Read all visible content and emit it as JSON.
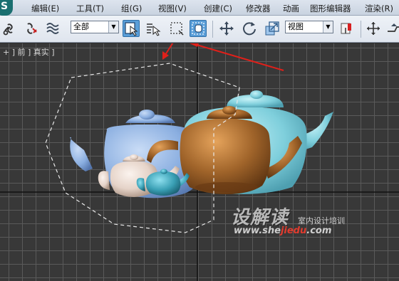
{
  "app": {
    "logo_glyph": "S"
  },
  "menu": [
    {
      "label": "编辑(E)"
    },
    {
      "label": "工具(T)"
    },
    {
      "label": "组(G)"
    },
    {
      "label": "视图(V)"
    },
    {
      "label": "创建(C)"
    },
    {
      "label": "修改器"
    },
    {
      "label": "动画"
    },
    {
      "label": "图形编辑器"
    },
    {
      "label": "渲染(R)"
    }
  ],
  "toolbar": {
    "selection_filter": "全部",
    "coordinate_system": "视图",
    "icons": [
      "link-icon",
      "unlink-icon",
      "bind-space-warp-icon",
      "select-object-icon",
      "select-by-name-icon",
      "selection-region-icon",
      "window-crossing-icon",
      "move-icon",
      "rotate-icon",
      "scale-icon",
      "pivot-icon",
      "manipulate-icon"
    ]
  },
  "viewport": {
    "label": "+ ] 前 ] 真实 ]",
    "view_name": "前",
    "shading": "真实",
    "grid_color": "#5a5a5a",
    "background_color": "#383838"
  },
  "scene_objects": [
    {
      "name": "teapot-cyan",
      "color": "#8fd3e0"
    },
    {
      "name": "teapot-blue",
      "color": "#8aaee0"
    },
    {
      "name": "teapot-orange",
      "color": "#a0642a"
    },
    {
      "name": "teapot-beige",
      "color": "#e5d3c8"
    },
    {
      "name": "teapot-small-teal",
      "color": "#3aa0b5"
    }
  ],
  "annotations": {
    "arrow_color": "#e0201a"
  },
  "watermark": {
    "title": "设解读",
    "subtitle": "室内设计培训",
    "url_prefix": "www.she",
    "url_highlight": "jiedu",
    "url_suffix": ".com"
  }
}
